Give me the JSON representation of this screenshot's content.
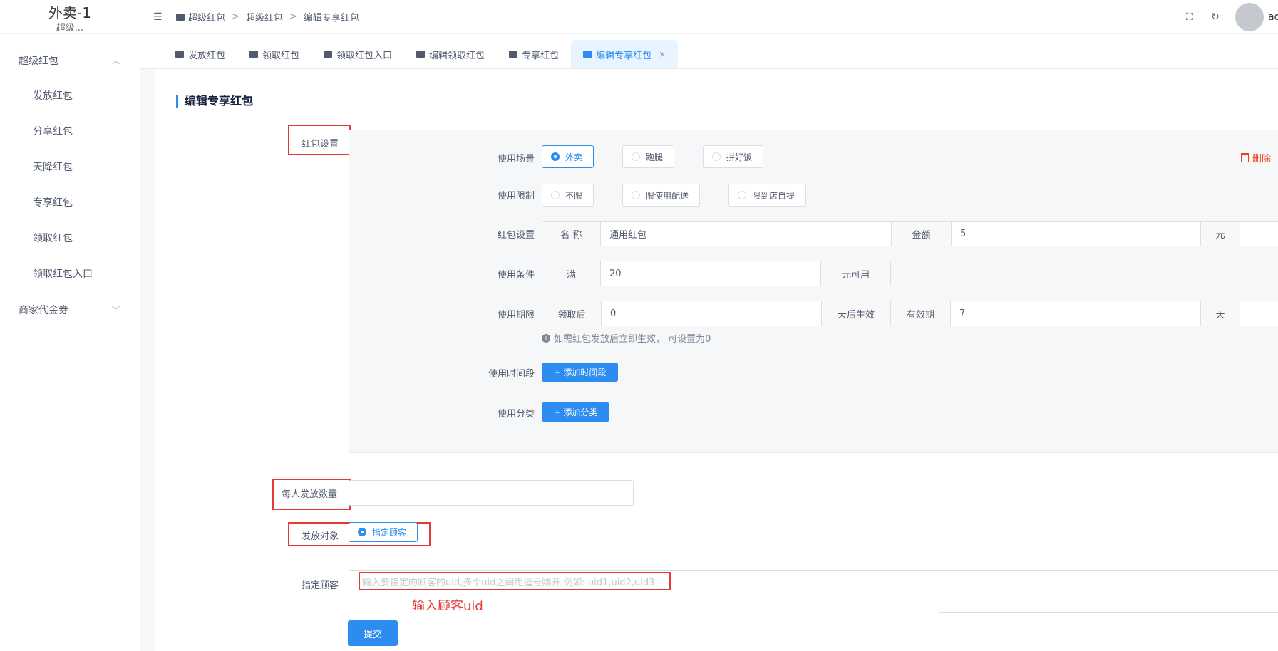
{
  "sidebar": {
    "logo_title": "外卖-1",
    "logo_sub": "超级...",
    "groups": [
      {
        "label": "超级红包",
        "expanded": true,
        "items": [
          "发放红包",
          "分享红包",
          "天降红包",
          "专享红包",
          "领取红包",
          "领取红包入口"
        ]
      },
      {
        "label": "商家代金券",
        "expanded": false
      }
    ]
  },
  "header": {
    "breadcrumb": [
      "超级红包",
      "超级红包",
      "编辑专享红包"
    ],
    "separator": ">",
    "user_initial": "ad"
  },
  "tabs": [
    {
      "label": "发放红包",
      "active": false
    },
    {
      "label": "领取红包",
      "active": false
    },
    {
      "label": "领取红包入口",
      "active": false
    },
    {
      "label": "编辑领取红包",
      "active": false
    },
    {
      "label": "专享红包",
      "active": false
    },
    {
      "label": "编辑专享红包",
      "active": true,
      "close": "×"
    }
  ],
  "page": {
    "title": "编辑专享红包",
    "section_label": "红包设置",
    "delete_label": "删除",
    "scene": {
      "label": "使用场景",
      "options": [
        "外卖",
        "跑腿",
        "拼好饭"
      ],
      "selected": "外卖"
    },
    "limit": {
      "label": "使用限制",
      "options": [
        "不限",
        "限使用配送",
        "限到店自提"
      ],
      "selected": ""
    },
    "packet": {
      "label": "红包设置",
      "name_addon": "名 称",
      "name_value": "通用红包",
      "amount_addon": "金额",
      "amount_value": "5",
      "unit": "元"
    },
    "condition": {
      "label": "使用条件",
      "prefix": "满",
      "value": "20",
      "suffix": "元可用"
    },
    "period": {
      "label": "使用期限",
      "prefix": "领取后",
      "value": "0",
      "mid": "天后生效",
      "valid_addon": "有效期",
      "valid_value": "7",
      "unit": "天"
    },
    "hint": "如需红包发放后立即生效， 可设置为0",
    "timeslot": {
      "label": "使用时间段",
      "button": "+ 添加时间段"
    },
    "category": {
      "label": "使用分类",
      "button": "+ 添加分类"
    },
    "per_person": {
      "label": "每人发放数量",
      "value": ""
    },
    "target": {
      "label": "发放对象",
      "option": "指定顾客"
    },
    "customers": {
      "label": "指定顾客",
      "placeholder": "输入要指定的顾客的uid,多个uid之间用逗号隔开,例如: uid1,uid2,uid3"
    },
    "annotation": "输入顾客uid",
    "submit": "提交"
  },
  "colors": {
    "primary": "#2d8cf0",
    "annotation_red": "#e53935",
    "danger": "#ed4014"
  }
}
